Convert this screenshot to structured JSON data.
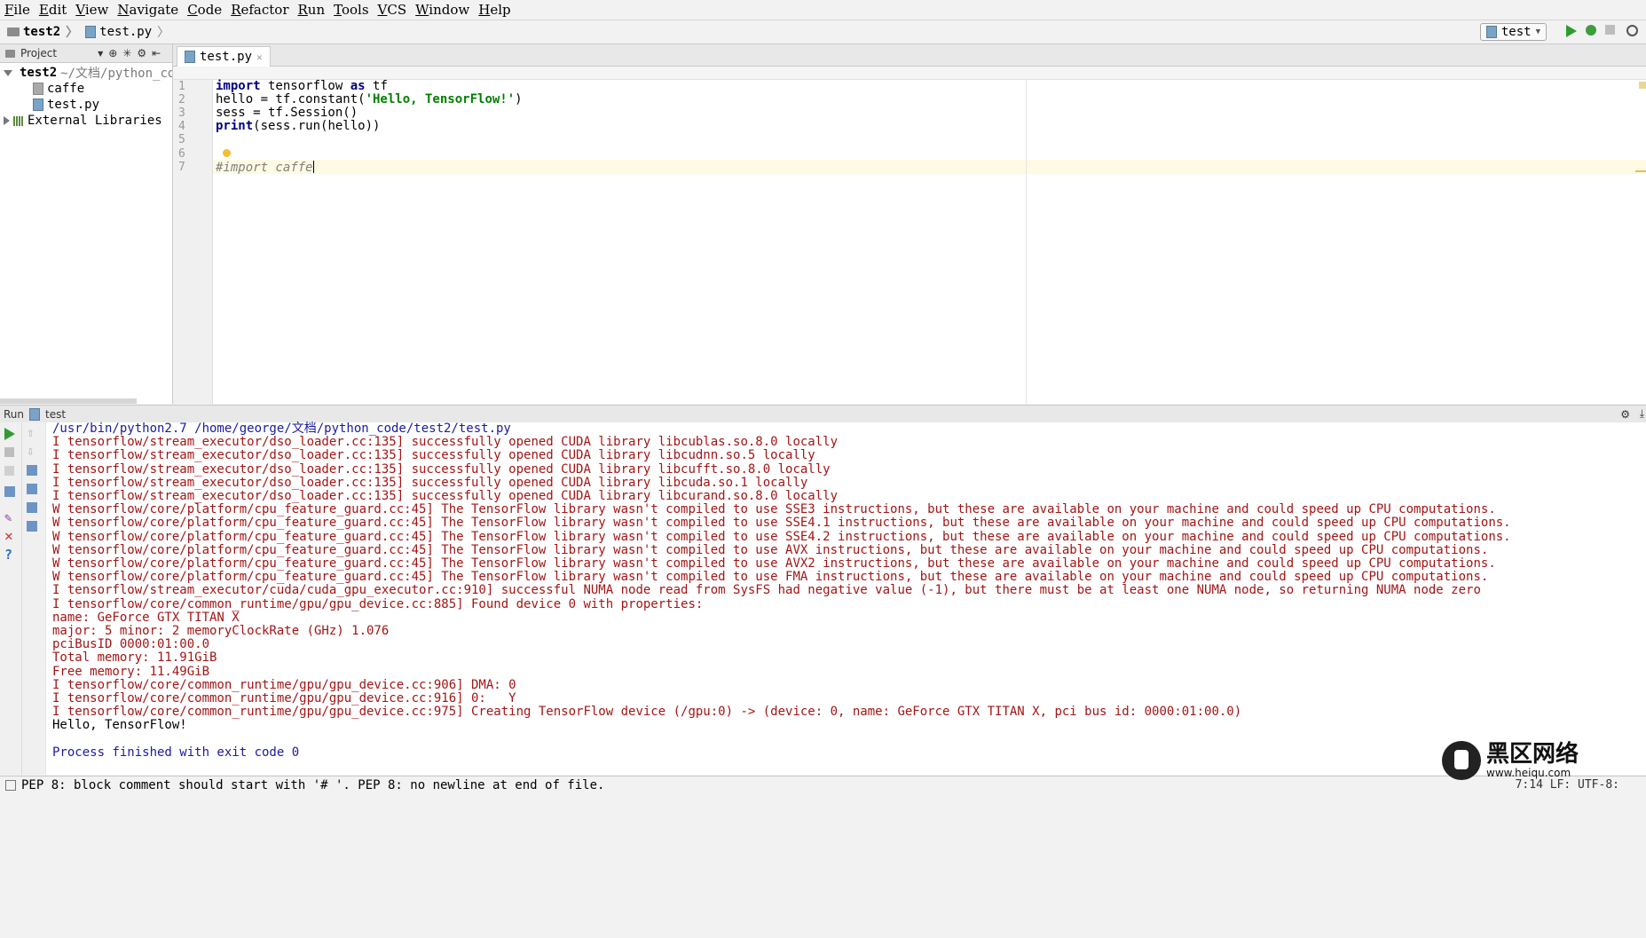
{
  "menu": [
    "File",
    "Edit",
    "View",
    "Navigate",
    "Code",
    "Refactor",
    "Run",
    "Tools",
    "VCS",
    "Window",
    "Help"
  ],
  "breadcrumb": {
    "project": "test2",
    "file": "test.py"
  },
  "run_config": "test",
  "project_panel": {
    "title": "Project",
    "root": {
      "name": "test2",
      "path": "~/文档/python_cod"
    },
    "items": [
      "caffe",
      "test.py"
    ],
    "external": "External Libraries"
  },
  "editor": {
    "tab": "test.py",
    "line_numbers": [
      "1",
      "2",
      "3",
      "4",
      "5",
      "6",
      "7"
    ],
    "lines": {
      "l1_kw": "import",
      "l1_rest": " tensorflow ",
      "l1_kw2": "as",
      "l1_end": " tf",
      "l2_pre": "hello = tf.constant(",
      "l2_str": "'Hello, TensorFlow!'",
      "l2_end": ")",
      "l3": "sess = tf.Session()",
      "l4_kw": "print",
      "l4_end": "(sess.run(hello))",
      "l7_cmt": "#import caffe"
    }
  },
  "run": {
    "label": "Run",
    "config": "test",
    "output": [
      "/usr/bin/python2.7 /home/george/文档/python_code/test2/test.py",
      "I tensorflow/stream_executor/dso_loader.cc:135] successfully opened CUDA library libcublas.so.8.0 locally",
      "I tensorflow/stream_executor/dso_loader.cc:135] successfully opened CUDA library libcudnn.so.5 locally",
      "I tensorflow/stream_executor/dso_loader.cc:135] successfully opened CUDA library libcufft.so.8.0 locally",
      "I tensorflow/stream_executor/dso_loader.cc:135] successfully opened CUDA library libcuda.so.1 locally",
      "I tensorflow/stream_executor/dso_loader.cc:135] successfully opened CUDA library libcurand.so.8.0 locally",
      "W tensorflow/core/platform/cpu_feature_guard.cc:45] The TensorFlow library wasn't compiled to use SSE3 instructions, but these are available on your machine and could speed up CPU computations.",
      "W tensorflow/core/platform/cpu_feature_guard.cc:45] The TensorFlow library wasn't compiled to use SSE4.1 instructions, but these are available on your machine and could speed up CPU computations.",
      "W tensorflow/core/platform/cpu_feature_guard.cc:45] The TensorFlow library wasn't compiled to use SSE4.2 instructions, but these are available on your machine and could speed up CPU computations.",
      "W tensorflow/core/platform/cpu_feature_guard.cc:45] The TensorFlow library wasn't compiled to use AVX instructions, but these are available on your machine and could speed up CPU computations.",
      "W tensorflow/core/platform/cpu_feature_guard.cc:45] The TensorFlow library wasn't compiled to use AVX2 instructions, but these are available on your machine and could speed up CPU computations.",
      "W tensorflow/core/platform/cpu_feature_guard.cc:45] The TensorFlow library wasn't compiled to use FMA instructions, but these are available on your machine and could speed up CPU computations.",
      "I tensorflow/stream_executor/cuda/cuda_gpu_executor.cc:910] successful NUMA node read from SysFS had negative value (-1), but there must be at least one NUMA node, so returning NUMA node zero",
      "I tensorflow/core/common_runtime/gpu/gpu_device.cc:885] Found device 0 with properties:",
      "name: GeForce GTX TITAN X",
      "major: 5 minor: 2 memoryClockRate (GHz) 1.076",
      "pciBusID 0000:01:00.0",
      "Total memory: 11.91GiB",
      "Free memory: 11.49GiB",
      "I tensorflow/core/common_runtime/gpu/gpu_device.cc:906] DMA: 0",
      "I tensorflow/core/common_runtime/gpu/gpu_device.cc:916] 0:   Y",
      "I tensorflow/core/common_runtime/gpu/gpu_device.cc:975] Creating TensorFlow device (/gpu:0) -> (device: 0, name: GeForce GTX TITAN X, pci bus id: 0000:01:00.0)",
      "Hello, TensorFlow!",
      "",
      "Process finished with exit code 0"
    ]
  },
  "status": {
    "message": "PEP 8: block comment should start with '# '. PEP 8: no newline at end of file.",
    "right": "7:14  LF:  UTF-8:"
  },
  "watermark": {
    "title": "黑区网络",
    "url": "www.heiqu.com"
  }
}
